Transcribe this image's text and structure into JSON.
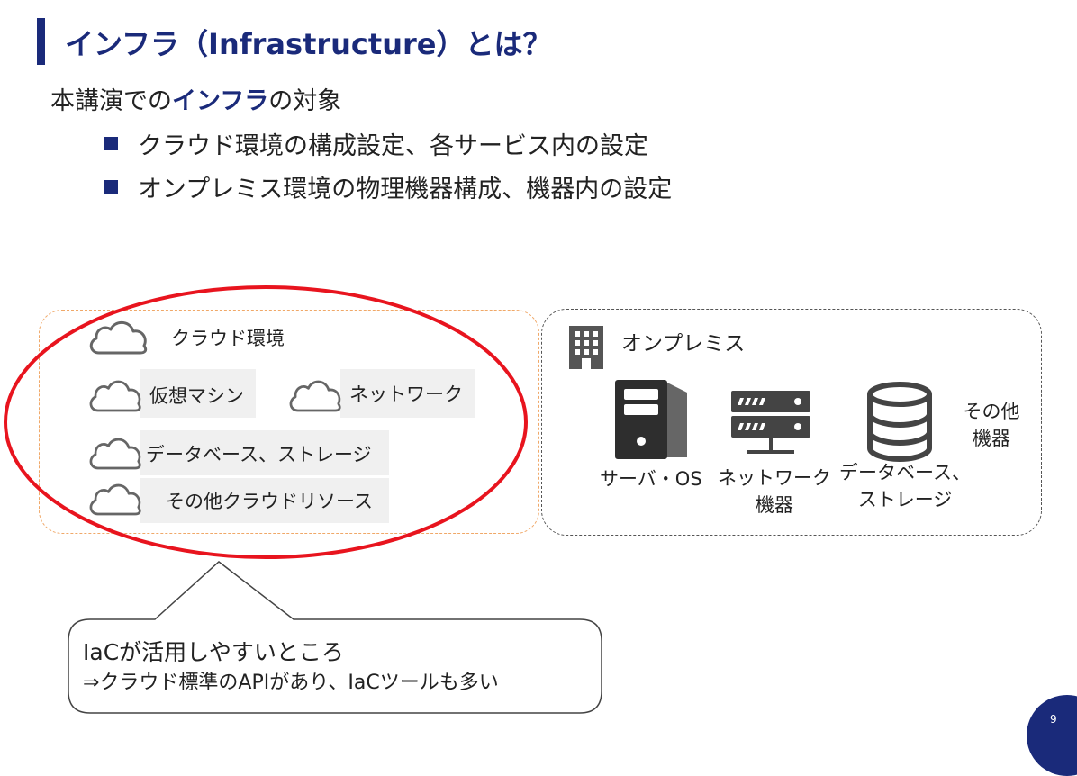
{
  "slide": {
    "title": "インフラ（Infrastructure）とは？",
    "subtitle": {
      "prefix": "本講演での",
      "emphasis": "インフラ",
      "suffix": "の対象"
    },
    "bullets": [
      "クラウド環境の構成設定、各サービス内の設定",
      "オンプレミス環境の物理機器構成、機器内の設定"
    ],
    "cloud_box": {
      "title": "クラウド環境",
      "items": [
        "仮想マシン",
        "ネットワーク",
        "データベース、ストレージ",
        "その他クラウドリソース"
      ]
    },
    "onprem_box": {
      "title": "オンプレミス",
      "items": {
        "server": "サーバ・OS",
        "network_line1": "ネットワーク",
        "network_line2": "機器",
        "db_line1": "データベース、",
        "db_line2": "ストレージ",
        "other_line1": "その他",
        "other_line2": "機器"
      }
    },
    "callout": {
      "line1": "IaCが活用しやすいところ",
      "line2": "⇒クラウド標準のAPIがあり、IaCツールも多い"
    },
    "page_number": "9",
    "colors": {
      "accent": "#1a2a7a",
      "highlight_ellipse": "#e8141e",
      "cloud_box_border": "#f0a868"
    }
  }
}
